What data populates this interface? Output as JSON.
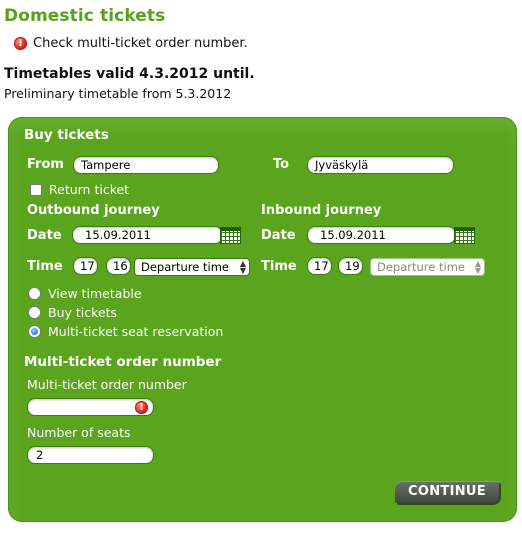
{
  "page": {
    "title": "Domestic tickets",
    "error_message": "Check multi-ticket order number.",
    "timetable_valid": "Timetables valid 4.3.2012 until.",
    "preliminary": "Preliminary timetable from 5.3.2012"
  },
  "form": {
    "heading": "Buy tickets",
    "from_label": "From",
    "from_value": "Tampere",
    "to_label": "To",
    "to_value": "Jyväskylä",
    "return_ticket_label": "Return ticket",
    "return_ticket_checked": false,
    "outbound": {
      "heading": "Outbound journey",
      "date_label": "Date",
      "date_value": "15.09.2011",
      "time_label": "Time",
      "hour": "17",
      "minute": "16",
      "time_type": "Departure time"
    },
    "inbound": {
      "heading": "Inbound journey",
      "date_label": "Date",
      "date_value": "15.09.2011",
      "time_label": "Time",
      "hour": "17",
      "minute": "19",
      "time_type": "Departure time"
    },
    "options": [
      {
        "label": "View timetable",
        "checked": false
      },
      {
        "label": "Buy tickets",
        "checked": false
      },
      {
        "label": "Multi-ticket seat reservation",
        "checked": true
      }
    ],
    "multi_heading": "Multi-ticket order number",
    "multi_field_label": "Multi-ticket order number",
    "multi_field_value": "",
    "seats_label": "Number of seats",
    "seats_value": "2",
    "continue_label": "CONTINUE"
  },
  "colors": {
    "brand_green": "#5aa01a",
    "panel_green": "#5aa51d",
    "error_red": "#d8221a"
  }
}
